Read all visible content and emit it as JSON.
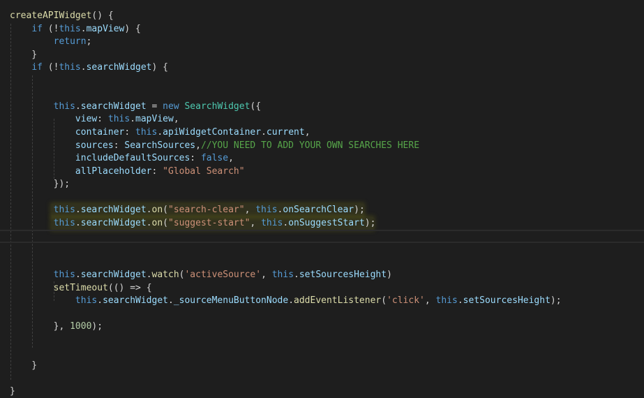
{
  "editor": {
    "lines": [
      [
        {
          "t": "createAPIWidget",
          "c": "func"
        },
        {
          "t": "() {",
          "c": "plain"
        }
      ],
      [
        {
          "t": "    ",
          "c": "plain"
        },
        {
          "t": "if",
          "c": "kw"
        },
        {
          "t": " (!",
          "c": "plain"
        },
        {
          "t": "this",
          "c": "kw"
        },
        {
          "t": ".",
          "c": "plain"
        },
        {
          "t": "mapView",
          "c": "var"
        },
        {
          "t": ") {",
          "c": "plain"
        }
      ],
      [
        {
          "t": "        ",
          "c": "plain"
        },
        {
          "t": "return",
          "c": "kw"
        },
        {
          "t": ";",
          "c": "plain"
        }
      ],
      [
        {
          "t": "    }",
          "c": "plain"
        }
      ],
      [
        {
          "t": "    ",
          "c": "plain"
        },
        {
          "t": "if",
          "c": "kw"
        },
        {
          "t": " (!",
          "c": "plain"
        },
        {
          "t": "this",
          "c": "kw"
        },
        {
          "t": ".",
          "c": "plain"
        },
        {
          "t": "searchWidget",
          "c": "var"
        },
        {
          "t": ") {",
          "c": "plain"
        }
      ],
      [],
      [],
      [
        {
          "t": "        ",
          "c": "plain"
        },
        {
          "t": "this",
          "c": "kw"
        },
        {
          "t": ".",
          "c": "plain"
        },
        {
          "t": "searchWidget",
          "c": "var"
        },
        {
          "t": " = ",
          "c": "plain"
        },
        {
          "t": "new",
          "c": "kw"
        },
        {
          "t": " ",
          "c": "plain"
        },
        {
          "t": "SearchWidget",
          "c": "cls"
        },
        {
          "t": "({",
          "c": "plain"
        }
      ],
      [
        {
          "t": "            ",
          "c": "plain"
        },
        {
          "t": "view",
          "c": "var"
        },
        {
          "t": ": ",
          "c": "plain"
        },
        {
          "t": "this",
          "c": "kw"
        },
        {
          "t": ".",
          "c": "plain"
        },
        {
          "t": "mapView",
          "c": "var"
        },
        {
          "t": ",",
          "c": "plain"
        }
      ],
      [
        {
          "t": "            ",
          "c": "plain"
        },
        {
          "t": "container",
          "c": "var"
        },
        {
          "t": ": ",
          "c": "plain"
        },
        {
          "t": "this",
          "c": "kw"
        },
        {
          "t": ".",
          "c": "plain"
        },
        {
          "t": "apiWidgetContainer",
          "c": "var"
        },
        {
          "t": ".",
          "c": "plain"
        },
        {
          "t": "current",
          "c": "var"
        },
        {
          "t": ",",
          "c": "plain"
        }
      ],
      [
        {
          "t": "            ",
          "c": "plain"
        },
        {
          "t": "sources",
          "c": "var"
        },
        {
          "t": ": ",
          "c": "plain"
        },
        {
          "t": "SearchSources",
          "c": "var"
        },
        {
          "t": ",",
          "c": "plain"
        },
        {
          "t": "//YOU NEED TO ADD YOUR OWN SEARCHES HERE",
          "c": "com"
        }
      ],
      [
        {
          "t": "            ",
          "c": "plain"
        },
        {
          "t": "includeDefaultSources",
          "c": "var"
        },
        {
          "t": ": ",
          "c": "plain"
        },
        {
          "t": "false",
          "c": "kw"
        },
        {
          "t": ",",
          "c": "plain"
        }
      ],
      [
        {
          "t": "            ",
          "c": "plain"
        },
        {
          "t": "allPlaceholder",
          "c": "var"
        },
        {
          "t": ": ",
          "c": "plain"
        },
        {
          "t": "\"Global Search\"",
          "c": "str"
        }
      ],
      [
        {
          "t": "        });",
          "c": "plain"
        }
      ],
      [],
      [
        {
          "t": "        ",
          "c": "plain"
        },
        {
          "t": "this",
          "c": "kw"
        },
        {
          "t": ".",
          "c": "plain"
        },
        {
          "t": "searchWidget",
          "c": "var"
        },
        {
          "t": ".",
          "c": "plain"
        },
        {
          "t": "on",
          "c": "func"
        },
        {
          "t": "(",
          "c": "plain"
        },
        {
          "t": "\"search-clear\"",
          "c": "str"
        },
        {
          "t": ", ",
          "c": "plain"
        },
        {
          "t": "this",
          "c": "kw"
        },
        {
          "t": ".",
          "c": "plain"
        },
        {
          "t": "onSearchClear",
          "c": "var"
        },
        {
          "t": ");",
          "c": "plain"
        }
      ],
      [
        {
          "t": "        ",
          "c": "plain"
        },
        {
          "t": "this",
          "c": "kw"
        },
        {
          "t": ".",
          "c": "plain"
        },
        {
          "t": "searchWidget",
          "c": "var"
        },
        {
          "t": ".",
          "c": "plain"
        },
        {
          "t": "on",
          "c": "func"
        },
        {
          "t": "(",
          "c": "plain"
        },
        {
          "t": "\"suggest-start\"",
          "c": "str"
        },
        {
          "t": ", ",
          "c": "plain"
        },
        {
          "t": "this",
          "c": "kw"
        },
        {
          "t": ".",
          "c": "plain"
        },
        {
          "t": "onSuggestStart",
          "c": "var"
        },
        {
          "t": ");",
          "c": "plain"
        }
      ],
      [],
      [],
      [],
      [
        {
          "t": "        ",
          "c": "plain"
        },
        {
          "t": "this",
          "c": "kw"
        },
        {
          "t": ".",
          "c": "plain"
        },
        {
          "t": "searchWidget",
          "c": "var"
        },
        {
          "t": ".",
          "c": "plain"
        },
        {
          "t": "watch",
          "c": "func"
        },
        {
          "t": "(",
          "c": "plain"
        },
        {
          "t": "'activeSource'",
          "c": "str"
        },
        {
          "t": ", ",
          "c": "plain"
        },
        {
          "t": "this",
          "c": "kw"
        },
        {
          "t": ".",
          "c": "plain"
        },
        {
          "t": "setSourcesHeight",
          "c": "var"
        },
        {
          "t": ")",
          "c": "plain"
        }
      ],
      [
        {
          "t": "        ",
          "c": "plain"
        },
        {
          "t": "setTimeout",
          "c": "func"
        },
        {
          "t": "(() => {",
          "c": "plain"
        }
      ],
      [
        {
          "t": "            ",
          "c": "plain"
        },
        {
          "t": "this",
          "c": "kw"
        },
        {
          "t": ".",
          "c": "plain"
        },
        {
          "t": "searchWidget",
          "c": "var"
        },
        {
          "t": ".",
          "c": "plain"
        },
        {
          "t": "_sourceMenuButtonNode",
          "c": "var"
        },
        {
          "t": ".",
          "c": "plain"
        },
        {
          "t": "addEventListener",
          "c": "func"
        },
        {
          "t": "(",
          "c": "plain"
        },
        {
          "t": "'click'",
          "c": "str"
        },
        {
          "t": ", ",
          "c": "plain"
        },
        {
          "t": "this",
          "c": "kw"
        },
        {
          "t": ".",
          "c": "plain"
        },
        {
          "t": "setSourcesHeight",
          "c": "var"
        },
        {
          "t": ");",
          "c": "plain"
        }
      ],
      [],
      [
        {
          "t": "        }, ",
          "c": "plain"
        },
        {
          "t": "1000",
          "c": "num"
        },
        {
          "t": ");",
          "c": "plain"
        }
      ],
      [],
      [],
      [
        {
          "t": "    }",
          "c": "plain"
        }
      ],
      [],
      [
        {
          "t": "}",
          "c": "plain"
        }
      ]
    ]
  },
  "colors": {
    "background": "#1e1e1e",
    "plain": "#d4d4d4",
    "kw": "#569cd6",
    "var": "#9cdcfe",
    "func": "#dcdcaa",
    "str": "#ce9178",
    "com": "#57a64a",
    "num": "#b5cea8",
    "cls": "#4ec9b0"
  }
}
